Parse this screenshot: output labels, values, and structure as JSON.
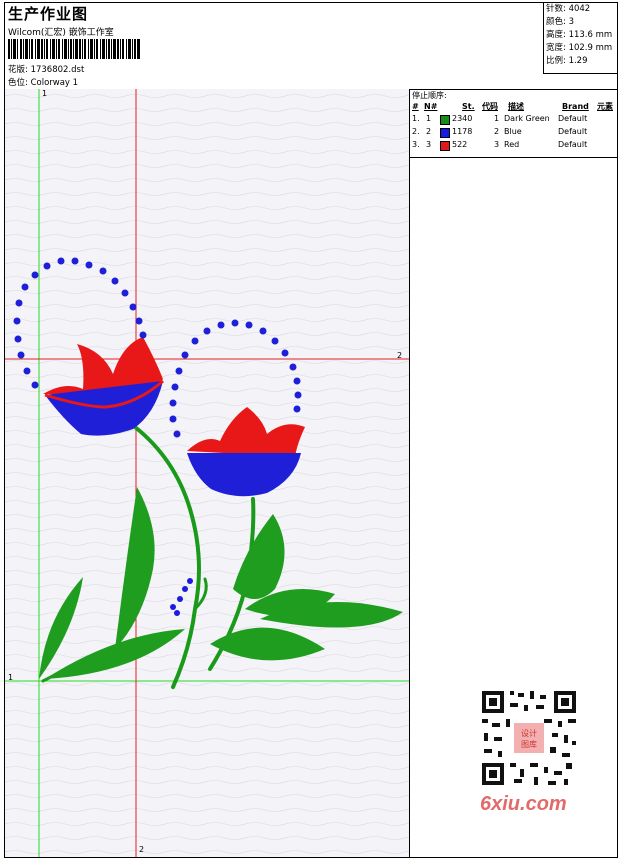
{
  "header": {
    "title": "生产作业图",
    "company": "Wilcom(汇宏) 嵌饰工作室",
    "design_label": "花版:",
    "design_value": "1736802.dst",
    "color_label": "色位:",
    "color_value": "Colorway 1"
  },
  "stats": {
    "stitches": "针数: 4042",
    "colors": "颜色: 3",
    "height": "高度: 113.6 mm",
    "width": "宽度: 102.9 mm",
    "ratio": "比例: 1.29"
  },
  "guides": {
    "v_green": "1",
    "h_green": "1",
    "h_red": "2",
    "v_red": "2"
  },
  "legend": {
    "title": "停止顺序:",
    "headers": {
      "num": "#",
      "no": "N#",
      "st": "St.",
      "code": "代码",
      "desc": "描述",
      "brand": "Brand",
      "elem": "元素"
    },
    "rows": [
      {
        "num": "1.",
        "no": "1",
        "color": "#1a8c1a",
        "st": "2340",
        "code": "1",
        "desc": "Dark Green",
        "brand": "Default"
      },
      {
        "num": "2.",
        "no": "2",
        "color": "#1a1ae0",
        "st": "1178",
        "code": "2",
        "desc": "Blue",
        "brand": "Default"
      },
      {
        "num": "3.",
        "no": "3",
        "color": "#e01a1a",
        "st": "522",
        "code": "3",
        "desc": "Red",
        "brand": "Default"
      }
    ]
  },
  "qr": {
    "badge": "设计 图库"
  },
  "watermark": "6xiu.com"
}
